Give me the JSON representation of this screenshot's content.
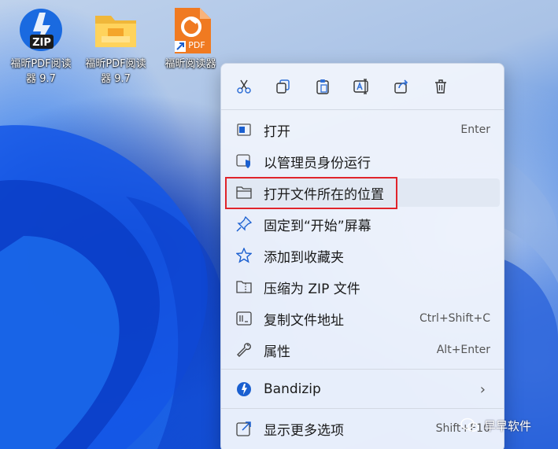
{
  "desktop": {
    "icons": [
      {
        "label_line1": "福昕PDF阅读",
        "label_line2": "器 9.7",
        "badge": "ZIP",
        "icon": "bandizip-zip-icon"
      },
      {
        "label_line1": "福昕PDF阅读",
        "label_line2": "器 9.7",
        "icon": "folder-icon"
      },
      {
        "label_line1": "福昕阅读器",
        "label_line2": "",
        "badge": "PDF",
        "icon": "foxit-pdf-shortcut-icon"
      }
    ]
  },
  "context_menu": {
    "quick_actions": [
      {
        "name": "cut",
        "icon": "scissors-icon"
      },
      {
        "name": "copy",
        "icon": "copy-icon"
      },
      {
        "name": "paste",
        "icon": "clipboard-icon"
      },
      {
        "name": "rename",
        "icon": "rename-icon"
      },
      {
        "name": "share",
        "icon": "share-icon"
      },
      {
        "name": "delete",
        "icon": "trash-icon"
      }
    ],
    "items": [
      {
        "label": "打开",
        "shortcut": "Enter",
        "icon": "open-app-icon"
      },
      {
        "label": "以管理员身份运行",
        "shortcut": "",
        "icon": "admin-shield-icon"
      },
      {
        "label": "打开文件所在的位置",
        "shortcut": "",
        "icon": "folder-outline-icon",
        "highlighted": true
      },
      {
        "label": "固定到“开始”屏幕",
        "shortcut": "",
        "icon": "pin-icon"
      },
      {
        "label": "添加到收藏夹",
        "shortcut": "",
        "icon": "star-icon"
      },
      {
        "label": "压缩为 ZIP 文件",
        "shortcut": "",
        "icon": "zip-folder-icon"
      },
      {
        "label": "复制文件地址",
        "shortcut": "Ctrl+Shift+C",
        "icon": "copy-path-icon"
      },
      {
        "label": "属性",
        "shortcut": "Alt+Enter",
        "icon": "wrench-icon"
      }
    ],
    "bandizip": {
      "label": "Bandizip",
      "icon": "bandizip-icon",
      "submenu": "›"
    },
    "more_options": {
      "label": "显示更多选项",
      "shortcut": "Shift+F10",
      "icon": "more-options-icon"
    }
  },
  "watermark": {
    "text": "早早软件",
    "icon": "wechat-icon"
  },
  "colors": {
    "highlight_border": "#e0242b",
    "accent": "#1a5fd0"
  }
}
